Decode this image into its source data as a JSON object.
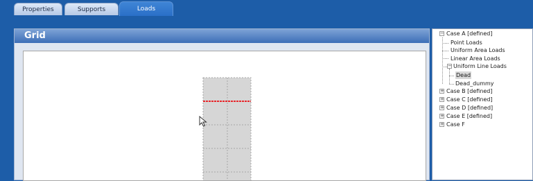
{
  "tabs": [
    {
      "label": "Properties",
      "active": false
    },
    {
      "label": "Supports",
      "active": false
    },
    {
      "label": "Loads",
      "active": true
    }
  ],
  "grid_panel": {
    "title": "Grid"
  },
  "tree": {
    "case_a": "Case A [defined]",
    "point_loads": "Point Loads",
    "uniform_area_loads": "Uniform Area Loads",
    "linear_area_loads": "Linear Area Loads",
    "uniform_line_loads": "Uniform Line Loads",
    "dead": "Dead",
    "dead_dummy": "Dead_dummy",
    "case_b": "Case B [defined]",
    "case_c": "Case C [defined]",
    "case_d": "Case D [defined]",
    "case_e": "Case E [defined]",
    "case_f": "Case F"
  },
  "colors": {
    "background": "#1d5da8",
    "active_tab": "#2a6fc7",
    "load_line": "#e8262a",
    "grid_fill": "#d6d6d6"
  },
  "icons": {
    "expand": "plus-box",
    "collapse": "minus-box",
    "cursor": "mouse-pointer"
  }
}
